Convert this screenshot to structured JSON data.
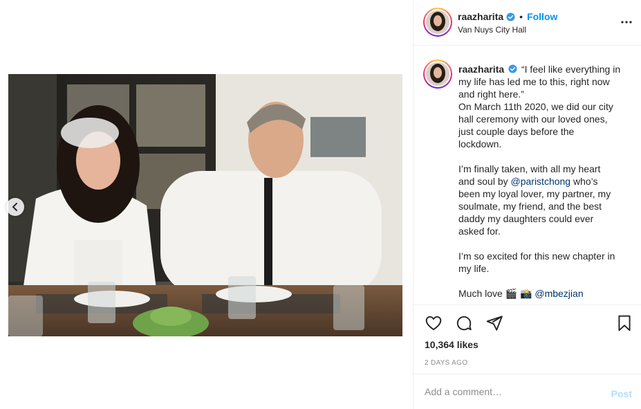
{
  "post": {
    "username": "raazharita",
    "location": "Van Nuys City Hall",
    "follow_label": "Follow",
    "dot": "•",
    "verified": true
  },
  "caption": {
    "username": "raazharita",
    "lines_p1": [
      "“I feel like everything in",
      "my life has led me to this, right now",
      "and right here.”",
      "On March 11th 2020, we did our city",
      "hall ceremony with our loved ones,",
      "just couple days before the",
      "lockdown."
    ],
    "p2_before_mention": "I’m finally taken, with all my heart",
    "p2_line2_prefix": "and soul by ",
    "p2_mention": "@paristchong",
    "p2_line2_suffix": " who’s",
    "p2_rest": [
      "been my loyal lover, my partner, my",
      "soulmate, my friend, and the best",
      "daddy my daughters could ever",
      "asked for."
    ],
    "p3": [
      "I’m so excited for this new chapter in",
      "my life."
    ],
    "p4_prefix": "Much love ",
    "p4_emoji": "🎬 📸",
    "p4_mention": "@mbezjian"
  },
  "engagement": {
    "likes": "10,364 likes",
    "timestamp": "2 DAYS AGO"
  },
  "comment_box": {
    "placeholder": "Add a comment…",
    "post_label": "Post"
  },
  "colors": {
    "accent": "#0095f6",
    "mention": "#00376b",
    "muted": "#8e8e8e",
    "post_disabled": "#b2dffc"
  },
  "icons": {
    "like": "heart-icon",
    "comment": "comment-icon",
    "share": "share-icon",
    "save": "bookmark-icon",
    "more": "more-icon",
    "prev": "chevron-left-icon",
    "verified": "verified-badge-icon"
  }
}
